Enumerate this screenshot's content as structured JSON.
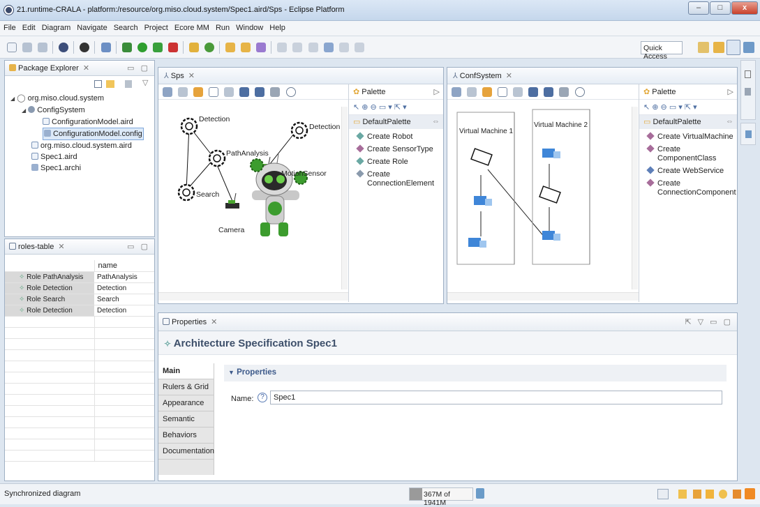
{
  "window": {
    "title": "21.runtime-CRALA - platform:/resource/org.miso.cloud.system/Spec1.aird/Sps - Eclipse Platform"
  },
  "menu": [
    "File",
    "Edit",
    "Diagram",
    "Navigate",
    "Search",
    "Project",
    "Ecore MM",
    "Run",
    "Window",
    "Help"
  ],
  "toolbar": {
    "quick_access": "Quick Access"
  },
  "package_explorer": {
    "title": "Package Explorer",
    "items": [
      {
        "label": "org.miso.cloud.system",
        "level": 0
      },
      {
        "label": "ConfigSystem",
        "level": 1
      },
      {
        "label": "ConfigurationModel.aird",
        "level": 2
      },
      {
        "label": "ConfigurationModel.config",
        "level": 2
      },
      {
        "label": "org.miso.cloud.system.aird",
        "level": 1
      },
      {
        "label": "Spec1.aird",
        "level": 1
      },
      {
        "label": "Spec1.archi",
        "level": 1
      }
    ]
  },
  "roles_table": {
    "title": "roles-table",
    "column": "name",
    "rows": [
      {
        "role": "Role PathAnalysis",
        "name": "PathAnalysis"
      },
      {
        "role": "Role Detection",
        "name": "Detection"
      },
      {
        "role": "Role Search",
        "name": "Search"
      },
      {
        "role": "Role Detection",
        "name": "Detection"
      }
    ]
  },
  "sps_editor": {
    "tab": "Sps",
    "nodes": {
      "detection1": "Detection",
      "pathanalysis": "PathAnalysis",
      "detection2": "Detection",
      "search": "Search",
      "motion": "MotionSensor",
      "camera": "Camera"
    },
    "palette": {
      "title": "Palette",
      "group": "DefaultPalette",
      "items": [
        "Create Robot",
        "Create SensorType",
        "Create Role",
        "Create ConnectionElement"
      ]
    }
  },
  "conf_editor": {
    "tab": "ConfSystem",
    "vm1": "Virtual Machine 1",
    "vm2": "Virtual Machine 2",
    "palette": {
      "title": "Palette",
      "group": "DefaultPalette",
      "items": [
        "Create VirtualMachine",
        "Create ComponentClass",
        "Create WebService",
        "Create ConnectionComponent"
      ]
    }
  },
  "properties": {
    "title": "Properties",
    "heading": "Architecture Specification Spec1",
    "tabs": [
      "Main",
      "Rulers & Grid",
      "Appearance",
      "Semantic",
      "Behaviors",
      "Documentation"
    ],
    "section": "Properties",
    "name_label": "Name:",
    "name_value": "Spec1"
  },
  "status": {
    "text": "Synchronized diagram",
    "memory": "367M of 1941M"
  }
}
